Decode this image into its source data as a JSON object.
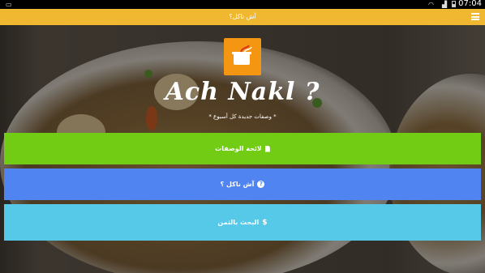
{
  "status_bar": {
    "time": "07:04"
  },
  "app_bar": {
    "title": "آش ناكل؟",
    "menu_icon": "hamburger-menu-icon"
  },
  "hero": {
    "logo_icon": "cooking-pot-icon",
    "brand": "Ach Nakl ?",
    "tagline": "* وصفات جديدة كل أسبوع *"
  },
  "buttons": [
    {
      "label": "لائحة الوصفات",
      "icon": "document-icon",
      "color": "#72cc14"
    },
    {
      "label": "آش ناكل ؟",
      "icon": "question-circle-icon",
      "color": "#5084f0"
    },
    {
      "label": "البحث بالثمن",
      "icon": "dollar-icon",
      "color": "#56c8e8"
    }
  ],
  "colors": {
    "app_bar": "#f0b830",
    "logo_bg": "#f49612"
  }
}
